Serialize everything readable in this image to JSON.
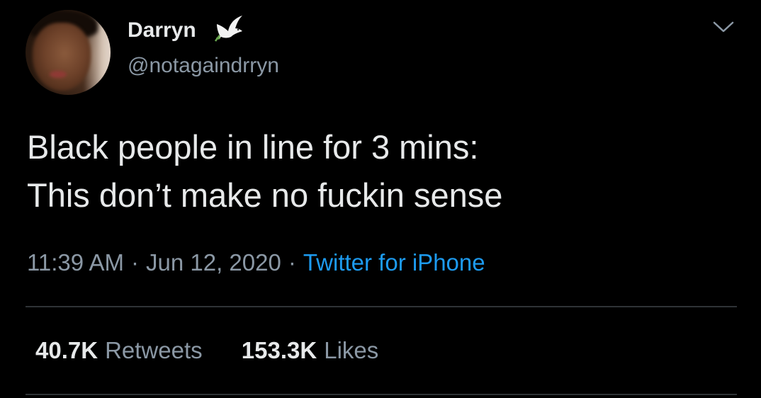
{
  "tweet": {
    "author": {
      "display_name": "Darryn",
      "handle": "@notagaindrryn",
      "badge_icon": "dove-icon"
    },
    "text_lines": [
      "Black people in line for 3 mins:",
      "This don’t make no fuckin sense"
    ],
    "time": "11:39 AM",
    "date": "Jun 12, 2020",
    "separator": "·",
    "source": "Twitter for iPhone",
    "stats": {
      "retweets_count": "40.7K",
      "retweets_label": "Retweets",
      "likes_count": "153.3K",
      "likes_label": "Likes"
    }
  },
  "colors": {
    "background": "#000000",
    "primary_text": "#e7e9ea",
    "secondary_text": "#8b98a5",
    "link": "#1d9bf0",
    "divider": "#2f3336"
  },
  "icons": {
    "more_menu": "chevron-down-icon"
  }
}
